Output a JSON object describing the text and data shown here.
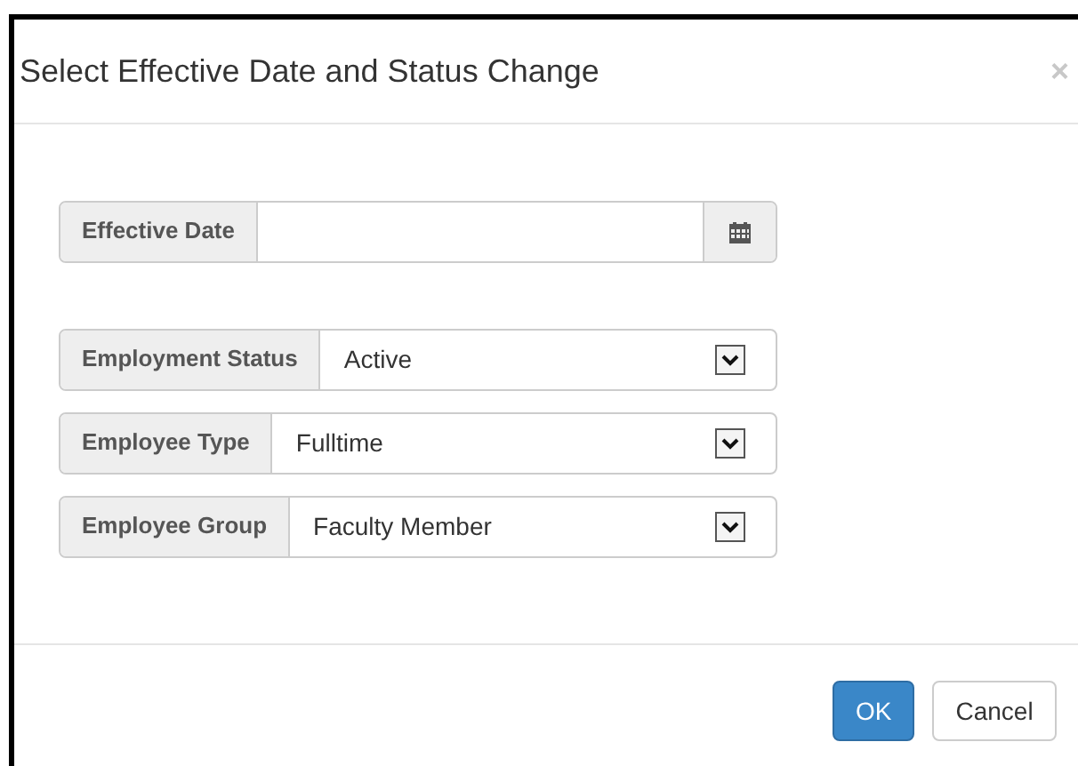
{
  "dialog": {
    "title": "Select Effective Date and Status Change",
    "close": "×"
  },
  "effective_date": {
    "label": "Effective Date"
  },
  "selects": [
    {
      "label": "Employment Status",
      "value": "Active"
    },
    {
      "label": "Employee Type",
      "value": "Fulltime"
    },
    {
      "label": "Employee Group",
      "value": "Faculty Member"
    }
  ],
  "buttons": [
    {
      "label": "OK",
      "kind": "primary"
    },
    {
      "label": "Cancel",
      "kind": "default"
    }
  ]
}
